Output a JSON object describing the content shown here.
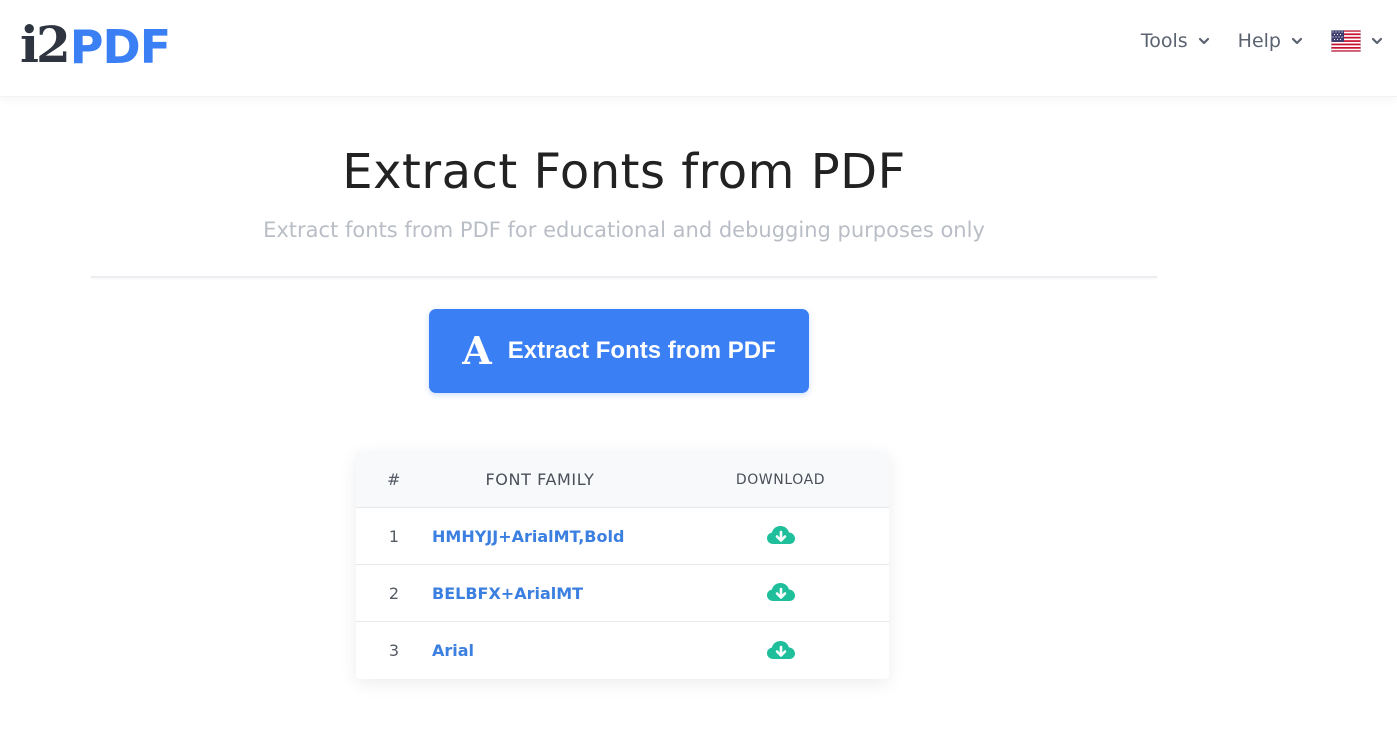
{
  "header": {
    "logo": {
      "prefix": "i2",
      "brand": "PDF"
    },
    "nav": [
      {
        "label": "Tools"
      },
      {
        "label": "Help"
      }
    ],
    "language_icon": "us-flag-icon"
  },
  "main": {
    "title": "Extract Fonts from PDF",
    "subtitle": "Extract fonts from PDF for educational and debugging purposes only",
    "cta": {
      "icon_glyph": "A",
      "label": "Extract Fonts from PDF"
    }
  },
  "table": {
    "headers": {
      "num": "#",
      "font_family": "FONT FAMILY",
      "download": "DOWNLOAD"
    },
    "rows": [
      {
        "num": "1",
        "font_family": "HMHYJJ+ArialMT,Bold"
      },
      {
        "num": "2",
        "font_family": "BELBFX+ArialMT"
      },
      {
        "num": "3",
        "font_family": "Arial"
      }
    ],
    "download_icon": "cloud-download-icon"
  },
  "colors": {
    "brand_blue": "#3b7ff5",
    "link_blue": "#3b7fe0",
    "download_green": "#1fbf9c",
    "logo_dark": "#2f3441"
  }
}
